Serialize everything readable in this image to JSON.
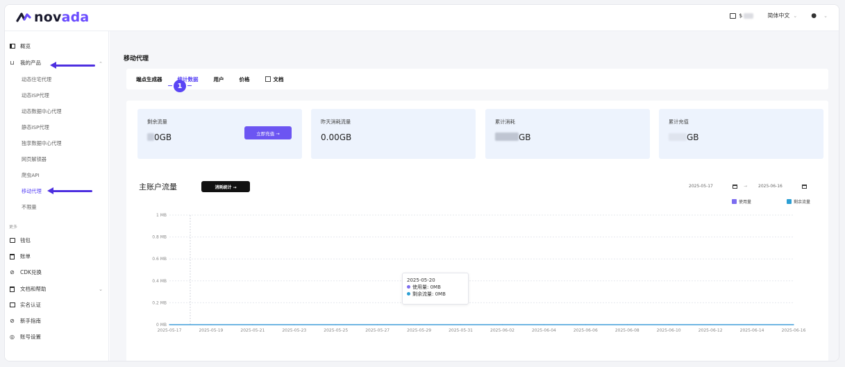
{
  "brand": {
    "name_part1": "nov",
    "name_accent": "ada",
    "name_part2": ""
  },
  "header": {
    "language": "简体中文",
    "balance_prefix": "$"
  },
  "sidebar": {
    "overview": "概览",
    "my_products": "我的产品",
    "sub_items": [
      "动态住宅代理",
      "动态ISP代理",
      "动态数据中心代理",
      "静态ISP代理",
      "独享数据中心代理",
      "网页解锁器",
      "爬虫API",
      "移动代理",
      "不限量"
    ],
    "active_sub": 7,
    "group_label": "更多",
    "others": [
      "钱包",
      "账单",
      "CDK兑换",
      "文档和帮助",
      "实名认证",
      "新手指南",
      "账号设置"
    ]
  },
  "page": {
    "title": "移动代理"
  },
  "tabs": [
    "端点生成器",
    "统计数据",
    "用户",
    "价格",
    "文档"
  ],
  "active_tab": 1,
  "step_badge": "1",
  "cards": [
    {
      "label": "剩余流量",
      "value": "0GB",
      "button": "立即充值 →"
    },
    {
      "label": "昨天消耗流量",
      "value": "0.00GB"
    },
    {
      "label": "累计消耗",
      "value": "GB"
    },
    {
      "label": "累计充值",
      "value": "GB"
    }
  ],
  "chart_section": {
    "title": "主账户流量",
    "stats_button": "消耗统计 →",
    "date_from": "2025-05-17",
    "date_sep": "→",
    "date_to": "2025-06-16"
  },
  "tooltip": {
    "date": "2025-05-20",
    "used_label": "使用量:",
    "used_value": "0MB",
    "remain_label": "剩余流量:",
    "remain_value": "0MB"
  },
  "chart_data": {
    "type": "line",
    "x": [
      "2025-05-17",
      "2025-05-19",
      "2025-05-21",
      "2025-05-23",
      "2025-05-25",
      "2025-05-27",
      "2025-05-29",
      "2025-05-31",
      "2025-06-02",
      "2025-06-04",
      "2025-06-06",
      "2025-06-08",
      "2025-06-10",
      "2025-06-12",
      "2025-06-14",
      "2025-06-16"
    ],
    "y_ticks": [
      "0 MB",
      "0.2 MB",
      "0.4 MB",
      "0.6 MB",
      "0.8 MB",
      "1 MB"
    ],
    "ylim": [
      0,
      1
    ],
    "series": [
      {
        "name": "使用量",
        "color": "#7c6cf0",
        "values": [
          0,
          0,
          0,
          0,
          0,
          0,
          0,
          0,
          0,
          0,
          0,
          0,
          0,
          0,
          0,
          0
        ]
      },
      {
        "name": "剩余流量",
        "color": "#2c9fd4",
        "values": [
          0,
          0,
          0,
          0,
          0,
          0,
          0,
          0,
          0,
          0,
          0,
          0,
          0,
          0,
          0,
          0
        ]
      }
    ],
    "grid": true,
    "legend": "top-right"
  }
}
